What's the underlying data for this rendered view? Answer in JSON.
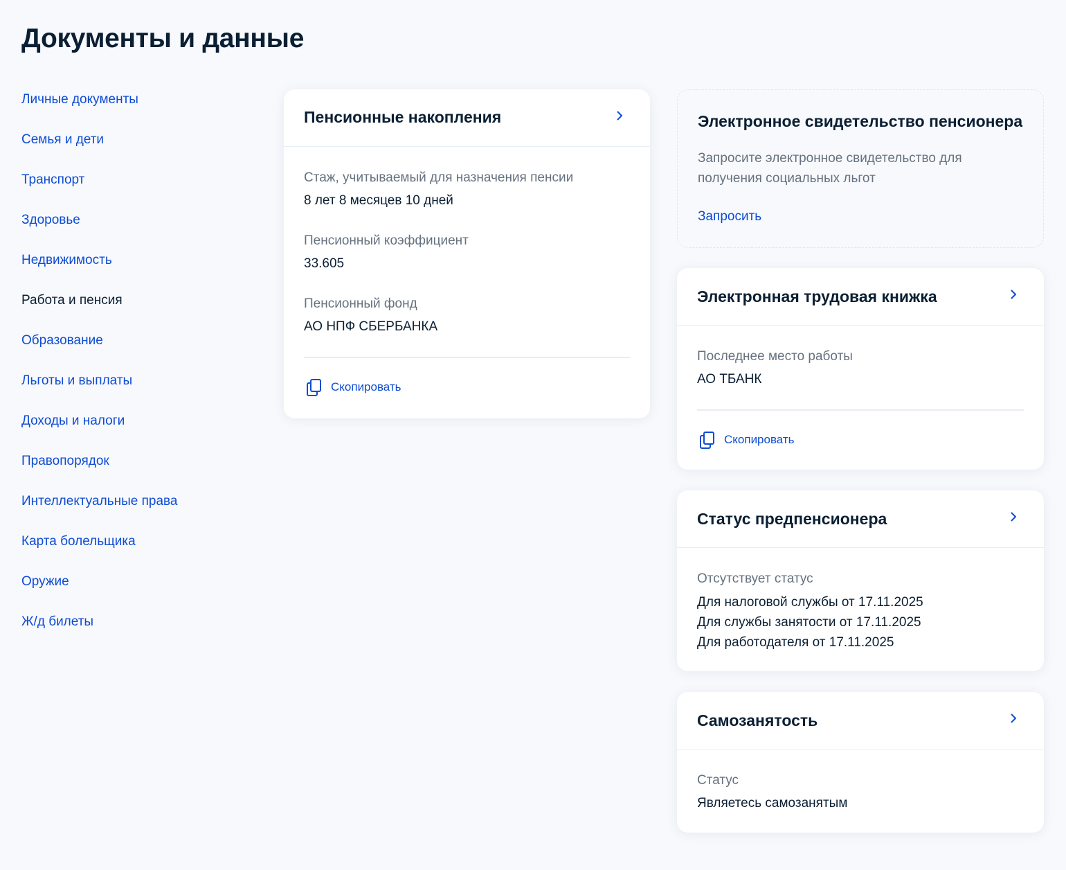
{
  "page": {
    "title": "Документы и данные"
  },
  "sidebar": {
    "items": [
      {
        "label": "Личные документы"
      },
      {
        "label": "Семья и дети"
      },
      {
        "label": "Транспорт"
      },
      {
        "label": "Здоровье"
      },
      {
        "label": "Недвижимость"
      },
      {
        "label": "Работа и пенсия",
        "active": true
      },
      {
        "label": "Образование"
      },
      {
        "label": "Льготы и выплаты"
      },
      {
        "label": "Доходы и налоги"
      },
      {
        "label": "Правопорядок"
      },
      {
        "label": "Интеллектуальные права"
      },
      {
        "label": "Карта болельщика"
      },
      {
        "label": "Оружие"
      },
      {
        "label": "Ж/д билеты"
      }
    ]
  },
  "pension_card": {
    "title": "Пенсионные накопления",
    "fields": [
      {
        "label": "Стаж, учитываемый для назначения пенсии",
        "value": "8 лет 8 месяцев 10 дней"
      },
      {
        "label": "Пенсионный коэффициент",
        "value": "33.605"
      },
      {
        "label": "Пенсионный фонд",
        "value": "АО НПФ СБЕРБАНКА"
      }
    ],
    "copy_label": "Скопировать"
  },
  "pensioner_certificate_card": {
    "title": "Электронное свидетельство пенсионера",
    "description": "Запросите электронное свидетельство для получения социальных льгот",
    "action_label": "Запросить"
  },
  "work_book_card": {
    "title": "Электронная трудовая книжка",
    "field_label": "Последнее место работы",
    "field_value": "АО ТБАНК",
    "copy_label": "Скопировать"
  },
  "prepension_card": {
    "title": "Статус предпенсионера",
    "status_label": "Отсутствует статус",
    "lines": [
      "Для налоговой службы от 17.11.2025",
      "Для службы занятости от 17.11.2025",
      "Для работодателя от 17.11.2025"
    ]
  },
  "self_employment_card": {
    "title": "Самозанятость",
    "field_label": "Статус",
    "field_value": "Являетесь самозанятым"
  },
  "colors": {
    "link": "#0d4cd3",
    "text": "#0b1f33",
    "muted": "#66727f",
    "background": "#f8f9fd"
  }
}
